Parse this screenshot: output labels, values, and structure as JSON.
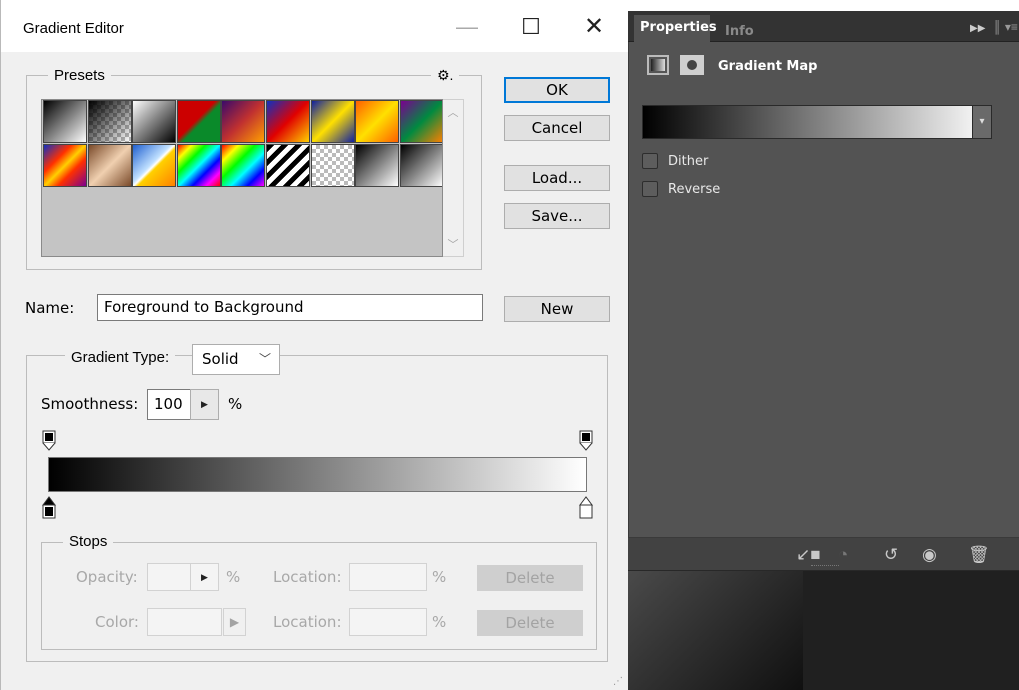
{
  "dialog": {
    "title": "Gradient Editor",
    "presets_label": "Presets",
    "buttons": {
      "ok": "OK",
      "cancel": "Cancel",
      "load": "Load...",
      "save": "Save...",
      "new": "New"
    },
    "name_label": "Name:",
    "name_value": "Foreground to Background",
    "gradient_type_label": "Gradient Type:",
    "gradient_type_value": "Solid",
    "smoothness_label": "Smoothness:",
    "smoothness_value": "100",
    "smoothness_unit": "%",
    "stops": {
      "label": "Stops",
      "opacity_label": "Opacity:",
      "opacity_unit": "%",
      "location_label_1": "Location:",
      "location_unit_1": "%",
      "delete_1": "Delete",
      "color_label": "Color:",
      "location_label_2": "Location:",
      "location_unit_2": "%",
      "delete_2": "Delete"
    }
  },
  "presets": [
    "linear-gradient(135deg,#000 0%,#fff 100%)",
    "linear-gradient(135deg,#000 0%,rgba(0,0,0,0) 100%),repeating-conic-gradient(#bbb 0 25%,#fff 0 50%) 0 0/8px 8px",
    "linear-gradient(135deg,#fff 0%,#000 100%)",
    "linear-gradient(135deg,#c00 0%,#c00 45%,#0a8a2a 55%,#0a8a2a 100%)",
    "linear-gradient(135deg,#3a0a6a 0%,#c03030 50%,#ffa000 100%)",
    "linear-gradient(135deg,#1030c0 0%,#e00000 50%,#ffd000 100%)",
    "linear-gradient(135deg,#1020a0 0%,#ffe000 50%,#1020a0 100%)",
    "linear-gradient(135deg,#ff6000 0%,#ffe000 50%,#ff6000 100%)",
    "linear-gradient(135deg,#7a0090 0%,#008a40 50%,#ff8000 100%)",
    "linear-gradient(135deg,#1030c0 0%,#ff3000 33%,#ffd000 50%,#ff3000 66%,#7a0090 100%)",
    "linear-gradient(135deg,#7a4a2a 0%,#f0d0b0 50%,#7a4a2a 100%)",
    "linear-gradient(135deg,#2060d0 0%,#c0e0ff 45%,#fff 50%,#ffd000 55%,#ff8000 100%)",
    "linear-gradient(135deg,#f00,#ff0,#0f0,#0ff,#00f,#f0f,#f00)",
    "linear-gradient(135deg,#f00,#ff0,#0f0,#0ff,#00f,#f0f),repeating-conic-gradient(#bbb 0 25%,#fff 0 50%) 0 0/8px 8px",
    "repeating-linear-gradient(135deg,#000 0 5px,#fff 5px 10px)",
    "repeating-conic-gradient(#bbb 0 25%,#fff 0 50%) 0 0/8px 8px",
    "linear-gradient(135deg,#000 0%,#fff 100%)",
    "linear-gradient(135deg,#000 0%,#fff 100%)"
  ],
  "properties_panel": {
    "tab_properties": "Properties",
    "tab_info": "Info",
    "title": "Gradient Map",
    "dither_label": "Dither",
    "reverse_label": "Reverse"
  },
  "colors": {
    "dialog_bg": "#f0f0f0",
    "ok_border": "#0078d7",
    "panel_bg": "#535353"
  }
}
